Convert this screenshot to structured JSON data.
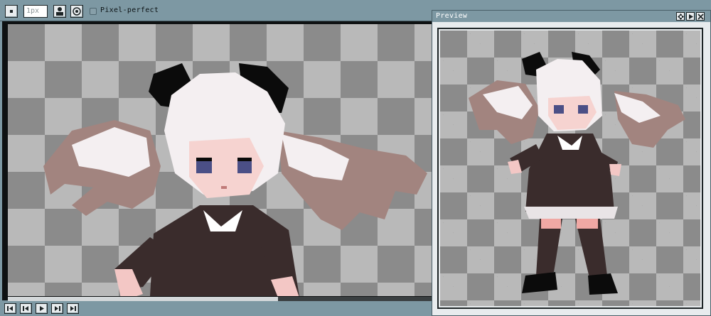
{
  "toolbar": {
    "pixel_size_value": "1px",
    "pixel_perfect_label": "Pixel-perfect",
    "pixel_perfect_checked": false
  },
  "preview": {
    "title": "Preview"
  },
  "icons": {
    "frame_icon": "frame-icon",
    "user_icon": "user-icon",
    "target_icon": "target-icon",
    "first_frame": "first-frame-icon",
    "prev_frame": "prev-frame-icon",
    "play": "play-icon",
    "next_frame": "next-frame-icon",
    "last_frame": "last-frame-icon"
  },
  "colors": {
    "chrome": "#7d98a3",
    "checker_light": "#b9b9b9",
    "checker_dark": "#8b8b8b",
    "hair": "#f4f0f2",
    "hair_shadow": "#9c7a80",
    "dress": "#3a2c2c",
    "bow": "#0b0b0b",
    "eyes": "#4b4f86",
    "skin": "#f3c7c5"
  }
}
